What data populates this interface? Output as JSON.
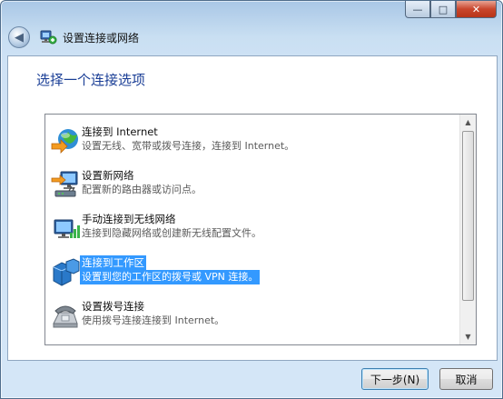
{
  "window": {
    "title": "设置连接或网络",
    "caption": {
      "minimize": "—",
      "maximize": "□",
      "close": "✕"
    },
    "back_glyph": "◀"
  },
  "heading": "选择一个连接选项",
  "options": [
    {
      "title": "连接到 Internet",
      "description": "设置无线、宽带或拨号连接，连接到 Internet。",
      "icon": "internet-globe-icon",
      "selected": false
    },
    {
      "title": "设置新网络",
      "description": "配置新的路由器或访问点。",
      "icon": "new-network-icon",
      "selected": false
    },
    {
      "title": "手动连接到无线网络",
      "description": "连接到隐藏网络或创建新无线配置文件。",
      "icon": "wireless-network-icon",
      "selected": false
    },
    {
      "title": "连接到工作区",
      "description": "设置到您的工作区的拨号或 VPN 连接。",
      "icon": "workplace-vpn-icon",
      "selected": true
    },
    {
      "title": "设置拨号连接",
      "description": "使用拨号连接连接到 Internet。",
      "icon": "dialup-phone-icon",
      "selected": false
    }
  ],
  "scrollbar": {
    "up": "▲",
    "down": "▼"
  },
  "buttons": {
    "next": "下一步(N)",
    "cancel": "取消"
  },
  "colors": {
    "selection": "#3399ff",
    "heading": "#1a3e96"
  }
}
